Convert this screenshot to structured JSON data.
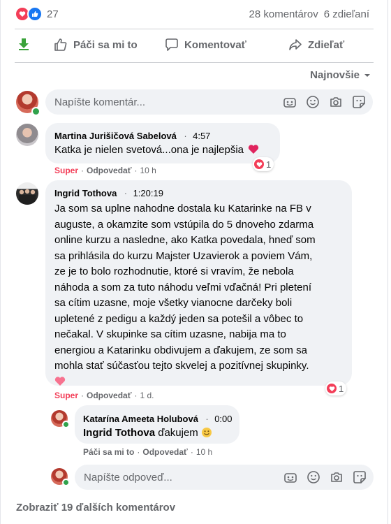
{
  "summary": {
    "reaction_count": "27",
    "comments": "28 komentárov",
    "shares": "6 zdieľaní"
  },
  "actions": {
    "like": "Páči sa mi to",
    "comment": "Komentovať",
    "share": "Zdieľať"
  },
  "sort": {
    "label": "Najnovšie"
  },
  "composer": {
    "placeholder": "Napíšte komentár..."
  },
  "comments": [
    {
      "author": "Martina Jurišičová Sabelová",
      "time": "4:57",
      "text": "Katka je nielen svetová...ona je najlepšia",
      "reaction_label": "Super",
      "reply_label": "Odpovedať",
      "age": "10 h",
      "reaction_count": "1"
    },
    {
      "author": "Ingrid Tothova",
      "time": "1:20:19",
      "text_lines": [
        "Ja som sa uplne nahodne dostala ku Katarinke na FB v",
        "auguste, a okamzite som vstúpila do 5 dnoveho zdarma",
        "online kurzu a nasledne, ako Katka povedala, hneď som",
        "sa prihlásila do kurzu Majster Uzavierok a poviem Vám,",
        "ze je to bolo rozhodnutie, ktoré si vravím, že nebola",
        "náhoda a som za tuto náhodu veľmi vďačná! Pri pletení",
        "sa cítim uzasne, moje všetky vianocne darčeky boli",
        "upletené z pedigu a každý jeden sa potešil a vôbec to",
        "nečakal. V skupinke sa cítim uzasne, nabija ma to",
        "energiou a Katarinku obdivujem a ďakujem, ze som sa",
        "mohla stať súčasťou tejto skvelej a pozitívnej skupinky."
      ],
      "reaction_label": "Super",
      "reply_label": "Odpovedať",
      "age": "1 d.",
      "reaction_count": "1"
    }
  ],
  "reply": {
    "author": "Katarína Ameeta Holubová",
    "time": "0:00",
    "mention": "Ingrid Tothova",
    "text": "ďakujem",
    "like_label": "Páči sa mi to",
    "reply_label": "Odpovedať",
    "age": "10 h"
  },
  "reply_composer": {
    "placeholder": "Napíšte odpoveď..."
  },
  "more_comments": "Zobraziť 19 ďalších komentárov",
  "colors": {
    "love": "#f33e58",
    "like": "#1877f2",
    "green_arrow": "#3aa33a",
    "online": "#31a24c"
  }
}
